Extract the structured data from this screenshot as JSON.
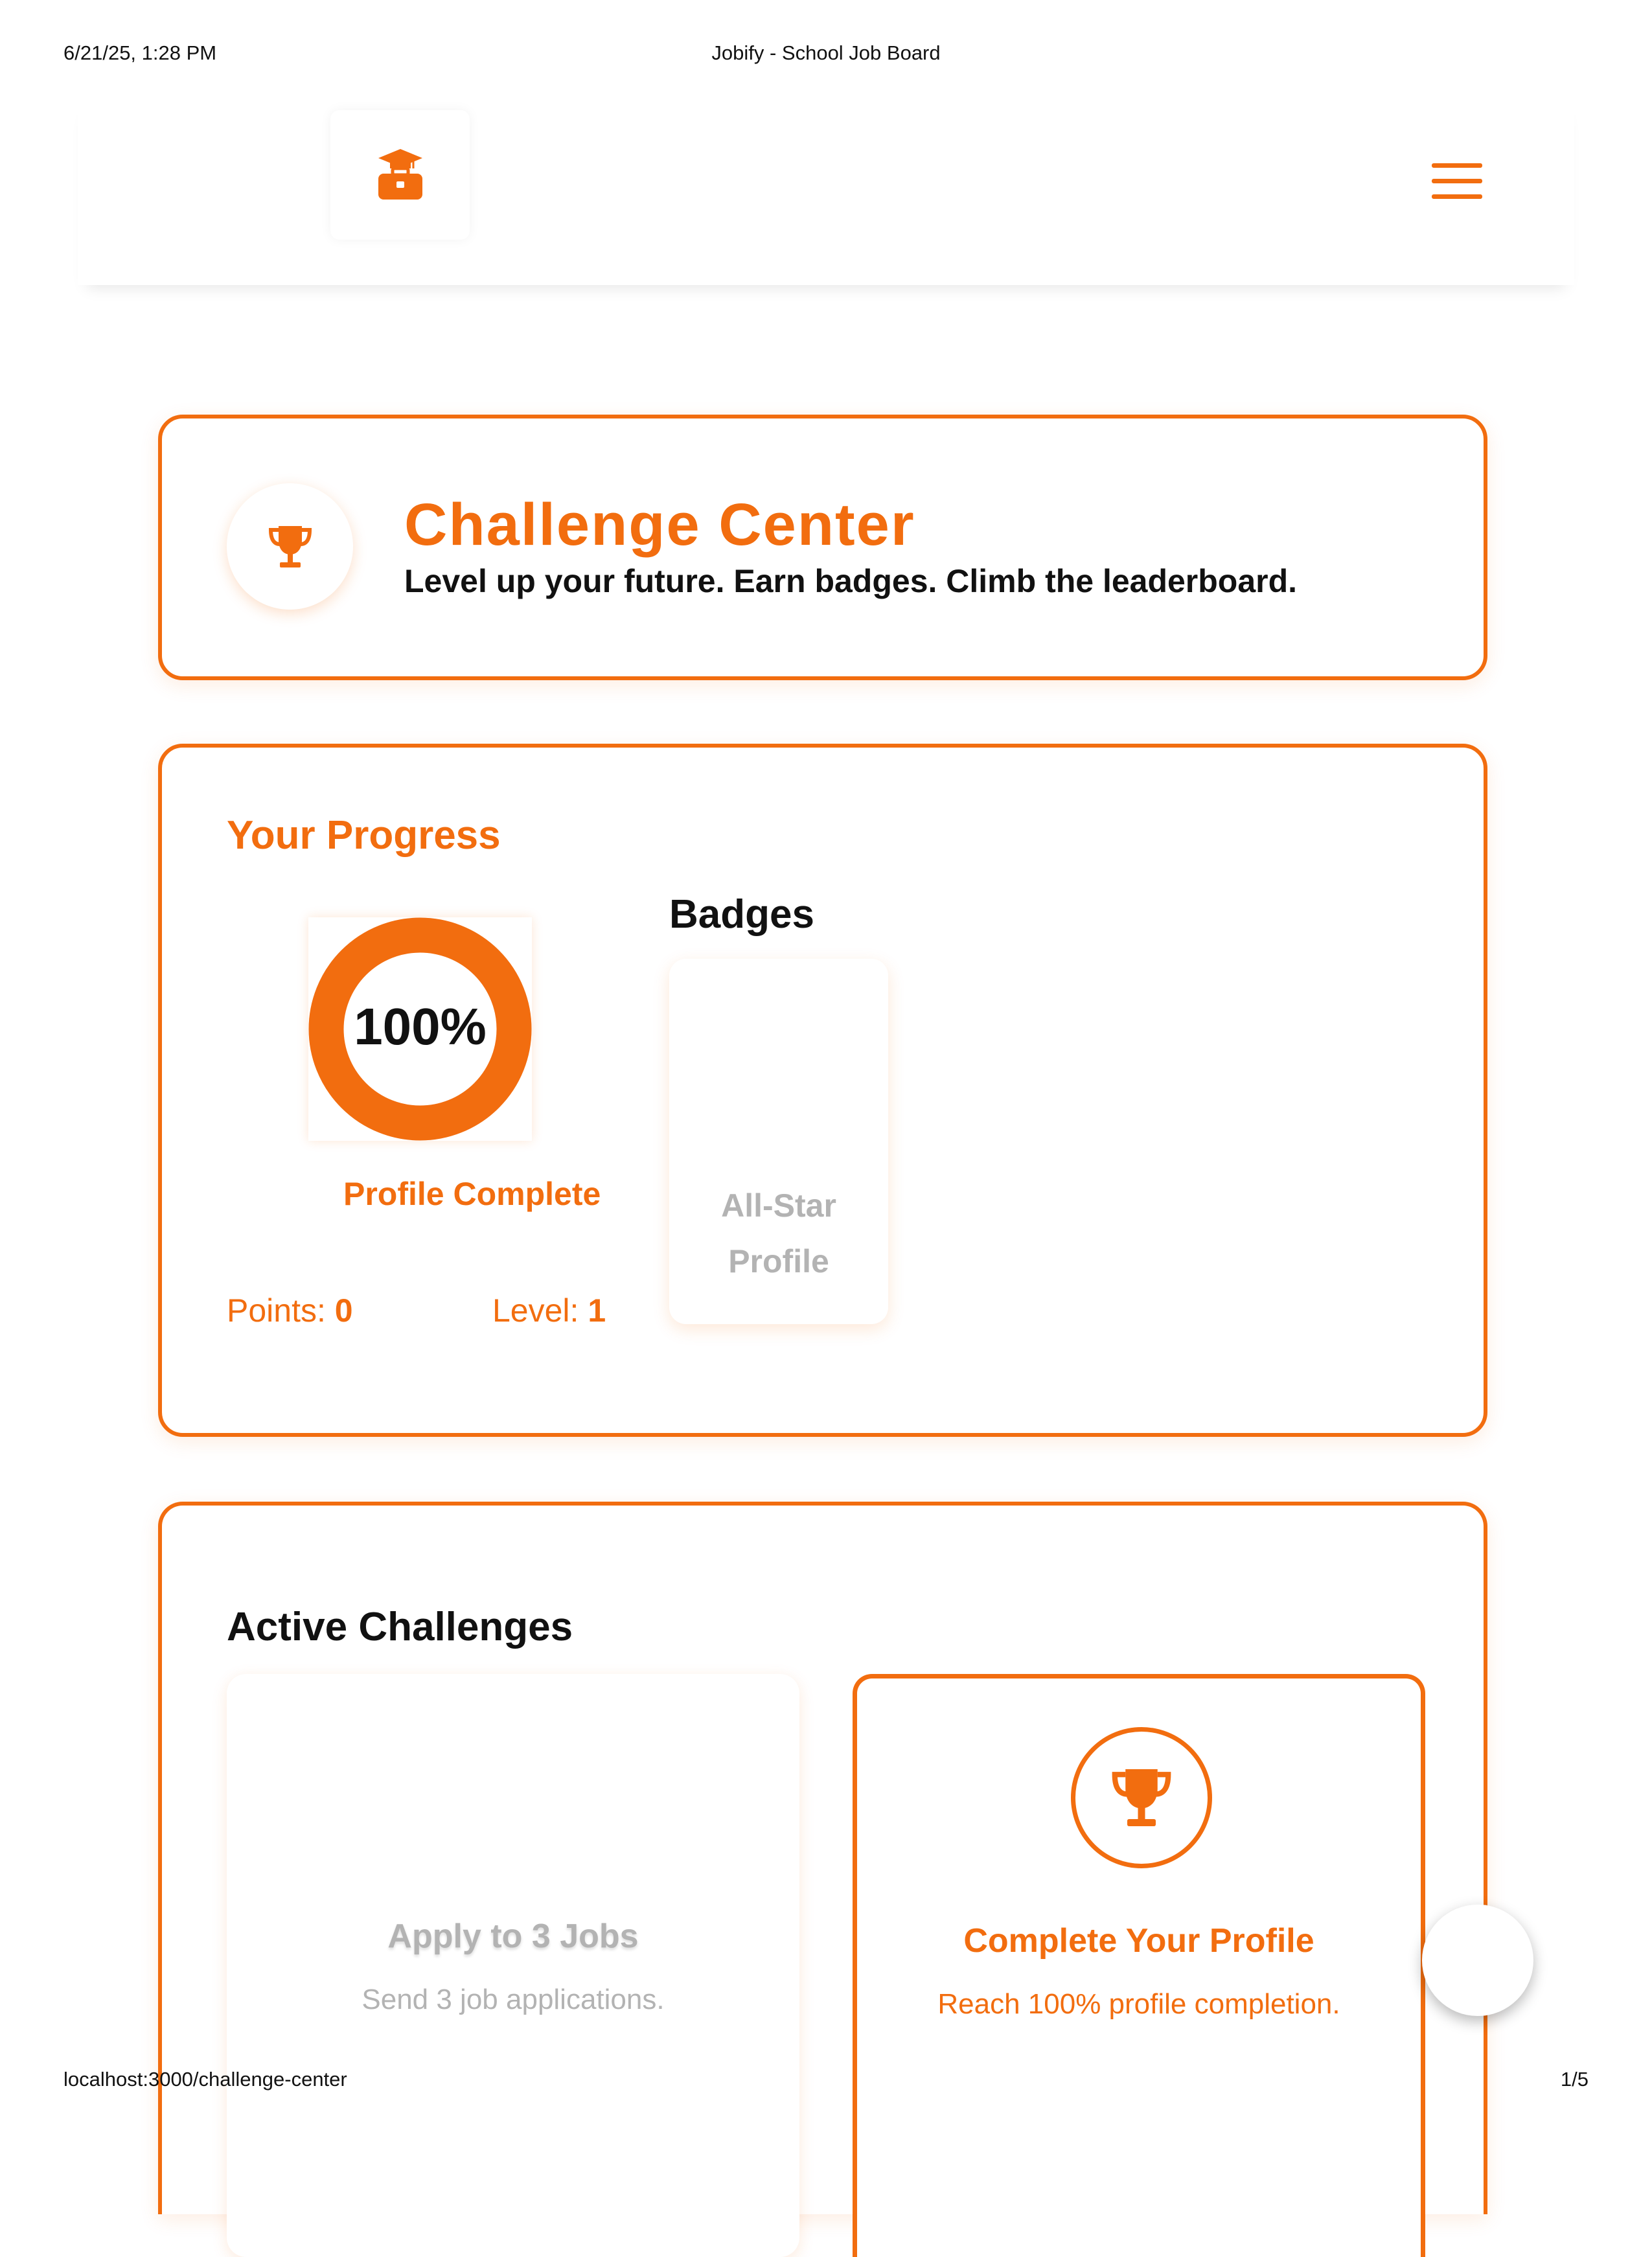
{
  "print_header": {
    "datetime": "6/21/25, 1:28 PM",
    "title": "Jobify - School Job Board"
  },
  "print_footer": {
    "url": "localhost:3000/challenge-center",
    "page": "1/5"
  },
  "navbar": {
    "logo_icon": "graduation-briefcase-icon",
    "menu_icon": "hamburger-menu-icon"
  },
  "hero": {
    "icon": "trophy-icon",
    "title": "Challenge Center",
    "subtitle": "Level up your future. Earn badges. Climb the leaderboard."
  },
  "progress": {
    "title": "Your Progress",
    "completion_percent": 100,
    "completion_text": "100%",
    "completion_label": "Profile Complete",
    "points_label": "Points: ",
    "points_value": "0",
    "level_label": "Level: ",
    "level_value": "1",
    "badges_title": "Badges",
    "badges": [
      {
        "name_line1": "All-Star",
        "name_line2": "Profile",
        "earned": false
      }
    ]
  },
  "challenges": {
    "title": "Active Challenges",
    "items": [
      {
        "title": "Apply to 3 Jobs",
        "description": "Send 3 job applications.",
        "completed": false
      },
      {
        "title": "Complete Your Profile",
        "description": "Reach 100% profile completion.",
        "completed": true,
        "icon": "trophy-icon"
      }
    ]
  },
  "colors": {
    "accent": "#f26d0f",
    "muted": "#b3b3b3",
    "text": "#111111"
  }
}
